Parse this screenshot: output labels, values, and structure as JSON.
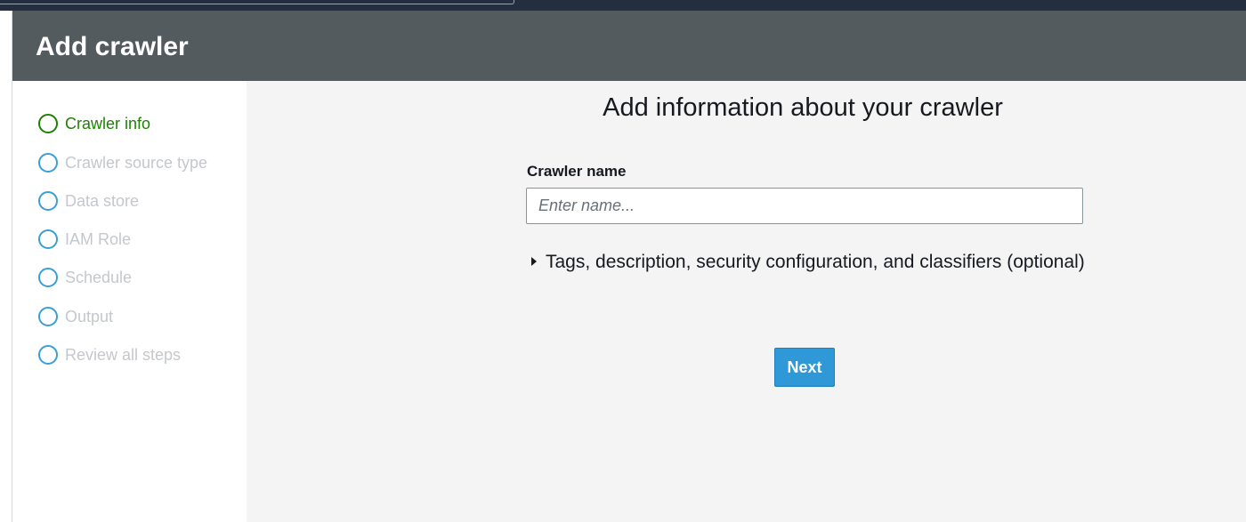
{
  "header": {
    "title": "Add crawler"
  },
  "sidebar": {
    "steps": [
      {
        "label": "Crawler info",
        "active": true
      },
      {
        "label": "Crawler source type",
        "active": false
      },
      {
        "label": "Data store",
        "active": false
      },
      {
        "label": "IAM Role",
        "active": false
      },
      {
        "label": "Schedule",
        "active": false
      },
      {
        "label": "Output",
        "active": false
      },
      {
        "label": "Review all steps",
        "active": false
      }
    ]
  },
  "main": {
    "heading": "Add information about your crawler",
    "crawler_name_label": "Crawler name",
    "crawler_name_value": "",
    "crawler_name_placeholder": "Enter name...",
    "expander_label": "Tags, description, security configuration, and classifiers (optional)",
    "next_label": "Next"
  },
  "colors": {
    "header_bg": "#545b5e",
    "active_step": "#1d8102",
    "inactive_ring": "#3a9fd6",
    "primary_button": "#2f99d8"
  }
}
